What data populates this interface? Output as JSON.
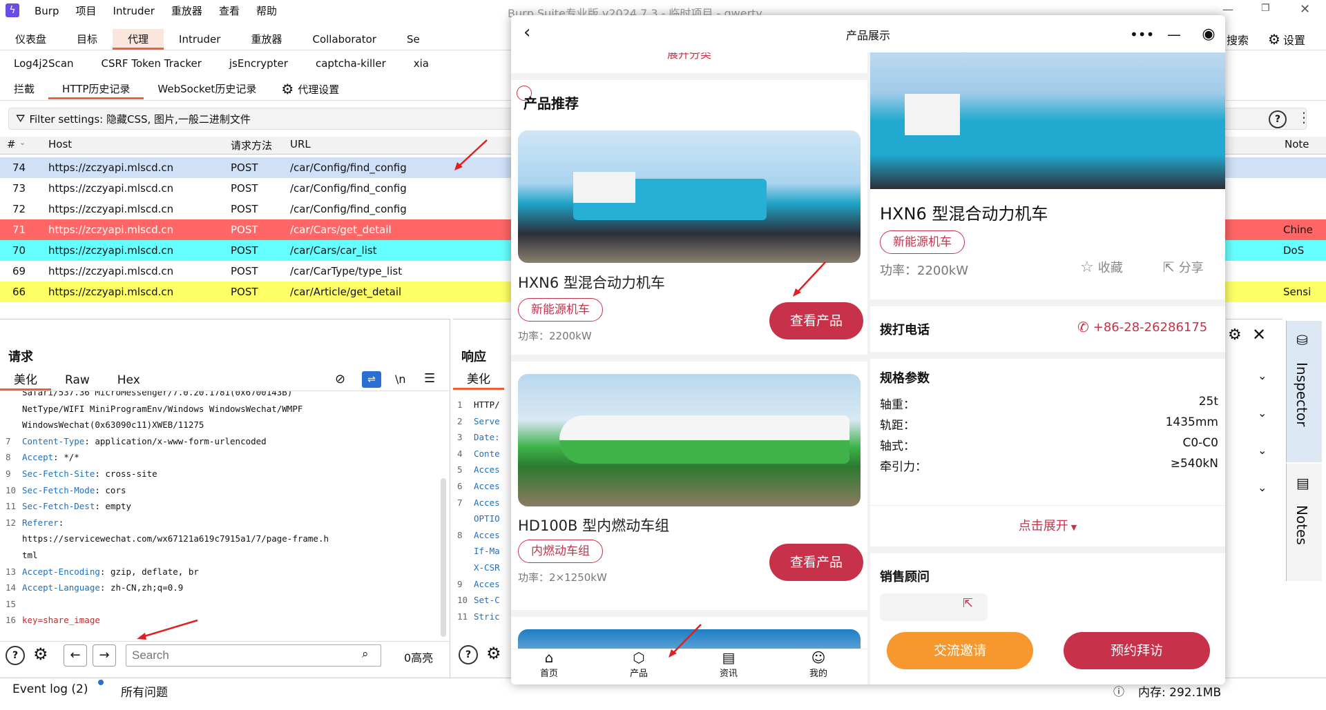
{
  "burp": {
    "app_menu": [
      "Burp",
      "项目",
      "Intruder",
      "重放器",
      "查看",
      "帮助"
    ],
    "window_title": "Burp Suite专业版  v2024.7.3 - 临时项目 - qwerty",
    "main_tabs": [
      "仪表盘",
      "目标",
      "代理",
      "Intruder",
      "重放器",
      "Collaborator",
      "Se"
    ],
    "right_tools": {
      "search": "搜索",
      "settings": "设置"
    },
    "ext_tabs": [
      "Log4j2Scan",
      "CSRF Token Tracker",
      "jsEncrypter",
      "captcha-killer",
      "xia"
    ],
    "proxy_tabs": [
      "拦截",
      "HTTP历史记录",
      "WebSocket历史记录"
    ],
    "proxy_settings": "代理设置",
    "filter": "Filter settings: 隐藏CSS, 图片,一般二进制文件",
    "columns": {
      "num": "#",
      "host": "Host",
      "method": "请求方法",
      "url": "URL",
      "note": "Note"
    },
    "rows": [
      {
        "num": "74",
        "host": "https://zczyapi.mlscd.cn",
        "method": "POST",
        "url": "/car/Config/find_config",
        "note": "",
        "bg": "#cfe0f7"
      },
      {
        "num": "73",
        "host": "https://zczyapi.mlscd.cn",
        "method": "POST",
        "url": "/car/Config/find_config",
        "note": "",
        "bg": "#ffffff"
      },
      {
        "num": "72",
        "host": "https://zczyapi.mlscd.cn",
        "method": "POST",
        "url": "/car/Config/find_config",
        "note": "",
        "bg": "#ffffff"
      },
      {
        "num": "71",
        "host": "https://zczyapi.mlscd.cn",
        "method": "POST",
        "url": "/car/Cars/get_detail",
        "note": "Chine",
        "bg": "#ff6666"
      },
      {
        "num": "70",
        "host": "https://zczyapi.mlscd.cn",
        "method": "POST",
        "url": "/car/Cars/car_list",
        "note": "DoS",
        "bg": "#66ffff"
      },
      {
        "num": "69",
        "host": "https://zczyapi.mlscd.cn",
        "method": "POST",
        "url": "/car/CarType/type_list",
        "note": "",
        "bg": "#ffffff"
      },
      {
        "num": "66",
        "host": "https://zczyapi.mlscd.cn",
        "method": "POST",
        "url": "/car/Article/get_detail",
        "note": "Sensi",
        "bg": "#ffff66"
      }
    ],
    "request": {
      "title": "请求",
      "tabs": [
        "美化",
        "Raw",
        "Hex"
      ],
      "newline_icon": "\\n",
      "lines": [
        {
          "n": "",
          "k": "",
          "v": "Safari/537.36 MicroMessenger/7.0.20.1781(0x6700143B)"
        },
        {
          "n": "",
          "k": "",
          "v": "NetType/WIFI MiniProgramEnv/Windows WindowsWechat/WMPF"
        },
        {
          "n": "",
          "k": "",
          "v": "WindowsWechat(0x63090c11)XWEB/11275"
        },
        {
          "n": "7",
          "k": "Content-Type",
          "v": ": application/x-www-form-urlencoded"
        },
        {
          "n": "8",
          "k": "Accept",
          "v": ": */*"
        },
        {
          "n": "9",
          "k": "Sec-Fetch-Site",
          "v": ": cross-site"
        },
        {
          "n": "10",
          "k": "Sec-Fetch-Mode",
          "v": ": cors"
        },
        {
          "n": "11",
          "k": "Sec-Fetch-Dest",
          "v": ": empty"
        },
        {
          "n": "12",
          "k": "Referer",
          "v": ":"
        },
        {
          "n": "",
          "k": "",
          "v": "https://servicewechat.com/wx67121a619c7915a1/7/page-frame.h"
        },
        {
          "n": "",
          "k": "",
          "v": "tml"
        },
        {
          "n": "13",
          "k": "Accept-Encoding",
          "v": ": gzip, deflate, br"
        },
        {
          "n": "14",
          "k": "Accept-Language",
          "v": ": zh-CN,zh;q=0.9"
        },
        {
          "n": "15",
          "k": "",
          "v": ""
        },
        {
          "n": "16",
          "k": "key",
          "v": "=share_image"
        }
      ],
      "search_placeholder": "Search",
      "highlights": "0高亮"
    },
    "response": {
      "title": "响应",
      "tab": "美化",
      "lines": [
        {
          "n": "1",
          "v": "HTTP/"
        },
        {
          "n": "2",
          "v": "Serve"
        },
        {
          "n": "3",
          "v": "Date:"
        },
        {
          "n": "4",
          "v": "Conte"
        },
        {
          "n": "5",
          "v": "Acces"
        },
        {
          "n": "6",
          "v": "Acces"
        },
        {
          "n": "7",
          "v": "Acces"
        },
        {
          "n": "",
          "v": "OPTIO"
        },
        {
          "n": "8",
          "v": "Acces"
        },
        {
          "n": "",
          "v": "If-Ma"
        },
        {
          "n": "",
          "v": "X-CSR"
        },
        {
          "n": "9",
          "v": "Acces"
        },
        {
          "n": "10",
          "v": "Set-C"
        },
        {
          "n": "11",
          "v": "Stric"
        }
      ]
    },
    "inspector": {
      "inspector_label": "Inspector",
      "notes_label": "Notes"
    },
    "status": {
      "event_log": "Event log (2)",
      "issues": "所有问题",
      "memory": "内存: 292.1MB"
    }
  },
  "mini": {
    "title": "产品展示",
    "top_cut_text": "展开分类",
    "section_title": "产品推荐",
    "products": [
      {
        "name": "HXN6 型混合动力机车",
        "tag": "新能源机车",
        "power": "功率：2200kW",
        "button": "查看产品"
      },
      {
        "name": "HD100B 型内燃动车组",
        "tag": "内燃动车组",
        "power": "功率：2×1250kW",
        "button": "查看产品"
      }
    ],
    "nav": [
      "首页",
      "产品",
      "资讯",
      "我的"
    ],
    "detail": {
      "name": "HXN6 型混合动力机车",
      "tag": "新能源机车",
      "power": "功率：2200kW",
      "fav": "收藏",
      "share": "分享",
      "phone_label": "拨打电话",
      "phone": "+86-28-26286175",
      "spec_title": "规格参数",
      "specs": [
        {
          "k": "轴重：",
          "v": "25t"
        },
        {
          "k": "轨距：",
          "v": "1435mm"
        },
        {
          "k": "轴式：",
          "v": "C0-C0"
        },
        {
          "k": "牵引力：",
          "v": "≥540kN"
        }
      ],
      "expand": "点击展开",
      "advisor": "销售顾问",
      "btn_left": "交流邀请",
      "btn_right": "预约拜访"
    }
  },
  "colors": {
    "accent": "#e8623c",
    "brand_red": "#c8314a",
    "orange": "#f7982f"
  }
}
